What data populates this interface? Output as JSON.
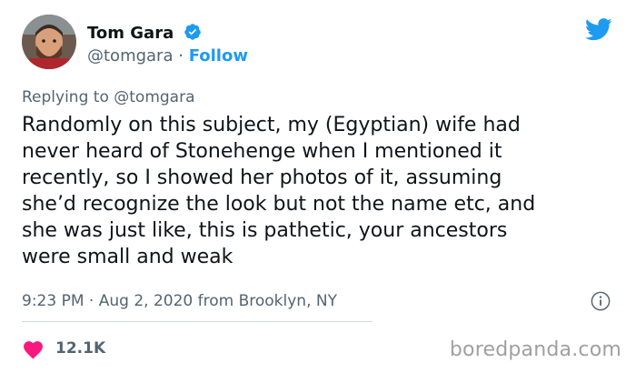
{
  "author": {
    "name": "Tom Gara",
    "handle": "@tomgara",
    "separator": "·",
    "follow_label": "Follow"
  },
  "reply": {
    "prefix": "Replying to",
    "mention": "@tomgara"
  },
  "tweet": {
    "lines": [
      "Randomly on this subject, my (Egyptian) wife had",
      "never heard of Stonehenge when I mentioned it",
      "recently, so I showed her photos of it, assuming",
      "she’d recognize the look but not the name etc, and",
      "she was just like, this is pathetic, your ancestors",
      "were small and weak"
    ]
  },
  "meta": {
    "time": "9:23 PM",
    "separator": "·",
    "date": "Aug 2, 2020",
    "from": "from",
    "location": "Brooklyn, NY"
  },
  "engagement": {
    "likes": "12.1K"
  },
  "watermark": "boredpanda.com",
  "colors": {
    "accent": "#1d9bf0",
    "like": "#f91880",
    "secondary_text": "#536471",
    "primary_text": "#0f1419"
  },
  "icons": {
    "verified": "verified-badge-icon",
    "brand": "twitter-bird-icon",
    "info": "info-icon",
    "like": "heart-icon"
  }
}
